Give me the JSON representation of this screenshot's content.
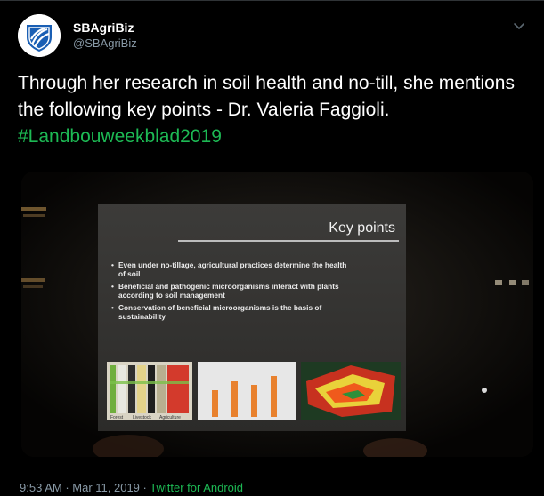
{
  "tweet": {
    "display_name": "SBAgriBiz",
    "handle": "@SBAgriBiz",
    "text": "Through her research in soil health and no-till, she mentions the following key points - Dr. Valeria Faggioli.",
    "hashtag": "#Landbouweekblad2019",
    "time": "9:53 AM",
    "date": "Mar 11, 2019",
    "separator": " · ",
    "source": "Twitter for Android"
  },
  "slide": {
    "title": "Key points",
    "bullets": [
      "Even under no-tillage, agricultural practices determine the health of soil",
      "Beneficial and pathogenic microorganisms interact with plants according to soil management",
      "Conservation of beneficial microorganisms is the basis of sustainability"
    ],
    "figure_labels": [
      "Forest",
      "Livestock",
      "Agriculture"
    ]
  },
  "icons": {
    "avatar": "standard-bank-logo",
    "caret": "chevron-down-icon"
  },
  "colors": {
    "background": "#000000",
    "accent_green": "#1db954",
    "brand_blue": "#1a5fb4",
    "muted": "#8899a6"
  }
}
